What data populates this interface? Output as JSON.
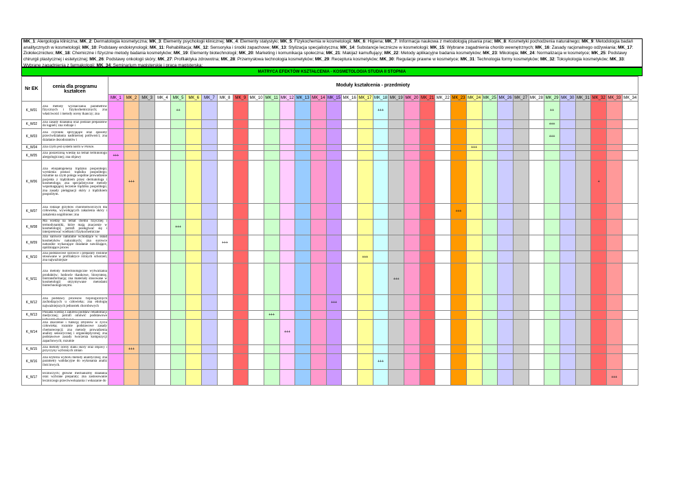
{
  "legend": [
    [
      "MK_1",
      "Alergologia kliniczna"
    ],
    [
      "MK_2",
      "Dermatologia kosmetyczna"
    ],
    [
      "MK_3",
      "Elementy psychologii klinicznej"
    ],
    [
      "MK_4",
      "Elementy statystyki"
    ],
    [
      "MK_5",
      "Fizykochemia w kosmetologii"
    ],
    [
      "MK_6",
      "Higiena"
    ],
    [
      "MK_7",
      "Informacja naukowa z metodologią pisania prac"
    ],
    [
      "MK_8",
      "Kosmetyki pochodzenia naturalnego"
    ],
    [
      "MK_9",
      "Metodologia badań analitycznych w kosmetologii"
    ],
    [
      "MK_10",
      "Podstawy endokrynologii"
    ],
    [
      "MK_11",
      "Rehabilitacja"
    ],
    [
      "MK_12",
      "Sensoryka i środki zapachowe"
    ],
    [
      "MK_13",
      "Stylizacja specjalistyczna"
    ],
    [
      "MK_14",
      "Substancje lecznicze w kosmetologii"
    ],
    [
      "MK_15",
      "Wybrane zagadnienia chorób wewnętrznych"
    ],
    [
      "MK_16",
      "Zasady racjonalnego odżywiania"
    ],
    [
      "MK_17",
      "Ziołolecznictwo"
    ],
    [
      "MK_18",
      "Chemiczne i fizyczne metody badania kosmetyków"
    ],
    [
      "MK_19",
      "Elementy biotechnologii"
    ],
    [
      "MK_20",
      "Marketing i komunikacja społeczna"
    ],
    [
      "MK_21",
      "Makijaż kamuflujący"
    ],
    [
      "MK_22",
      "Metody aplikacyjne badania kosmetyków"
    ],
    [
      "MK_23",
      "Mikologia"
    ],
    [
      "MK_24",
      "Normalizacja w kosmetyce"
    ],
    [
      "MK_25",
      "Podstawy chirurgii plastycznej i estetycznej"
    ],
    [
      "MK_26",
      "Podstawy onkologii skóry"
    ],
    [
      "MK_27",
      "Profilaktyka zdrowotna"
    ],
    [
      "MK_28",
      "Przemysłowa technologia kosmetyków"
    ],
    [
      "MK_29",
      "Receptura kosmetyków"
    ],
    [
      "MK_30",
      "Regulacje prawne w kosmetyce"
    ],
    [
      "MK_31",
      "Technologia formy kosmetyków"
    ],
    [
      "MK_32",
      "Toksykologia kosmetyków"
    ],
    [
      "MK_33",
      "Wybrane zagadnienia z farmakologii"
    ],
    [
      "MK_34",
      "Seminarium magisterskie i praca magisterska"
    ]
  ],
  "title": "MATRYCA EFEKTÓW KSZTAŁCENIA - KOSMETOLOGIA STUDIA II STOPNIA",
  "header": {
    "col_code": "Nr EK",
    "col_desc": "cenia dla programu kształcen",
    "modules_title": "Moduły kształcenia - przedmioty"
  },
  "modules": [
    "MK_1",
    "MK_2",
    "MK_3",
    "MK_4",
    "MK_5",
    "MK_6",
    "MK_7",
    "MK_8",
    "MK_9",
    "MK_10",
    "MK_11",
    "MK_12",
    "MK_13",
    "MK_14",
    "MK_15",
    "MK_16",
    "MK_17",
    "MK_18",
    "MK_19",
    "MK_20",
    "MK_21",
    "MK_22",
    "MK_23",
    "MK_24",
    "MK_25",
    "MK_26",
    "MK_27",
    "MK_28",
    "MK_29",
    "MK_30",
    "MK_31",
    "MK_32",
    "MK_33",
    "MK_34"
  ],
  "column_colors": [
    "#ff99ff",
    "#ffcc99",
    "#cccccc",
    "#ffffff",
    "#ccffcc",
    "#ffff99",
    "#ccccff",
    "#ffffff",
    "#ff6666",
    "#ffffff",
    "#ccffcc",
    "#ffccff",
    "#99ccff",
    "#ff99cc",
    "#cc99ff",
    "#ffffff",
    "#ffff99",
    "#ccffff",
    "#cccccc",
    "#ff99cc",
    "#ff6666",
    "#ffffff",
    "#ff9900",
    "#ffff99",
    "#ccffcc",
    "#ccccff",
    "#cccccc",
    "#ffffff",
    "#ccffcc",
    "#ccccff",
    "#cccccc",
    "#ff6666",
    "#ff9999",
    "#ffffff"
  ],
  "rows": [
    {
      "code": "K_W01",
      "desc": "Zna metody wyznaczania parametrów fizycznych i fizykochemicznych; zna właściwości i metody oceny tkanczy; zna",
      "marks": {
        "4": "++",
        "17": "+++",
        "28": "++"
      }
    },
    {
      "code": "K_W02",
      "desc": "Zna zasady działania oraz podział preparatów do kąpieli; zna rodzaje i",
      "marks": {
        "28": "+++"
      }
    },
    {
      "code": "K_W03",
      "desc": "Zna czynniki sprzyjające oraz sposoby przeciwdziałania nadmiernej potliwości; zna działanie dezodorantów i",
      "marks": {
        "28": "+++"
      }
    },
    {
      "code": "K_W04",
      "desc": "Zna czym jest system norm w Polsce.",
      "marks": {
        "23": "+++"
      }
    },
    {
      "code": "K_W05",
      "desc": "Zna poszerzoną wiedzę na temat terminologii alergologicznej; zna objawy",
      "marks": {
        "0": "+++"
      }
    },
    {
      "code": "K_W06",
      "desc": "Zna etiopatogenezę trądziku pospolitego; wymienia postaci trądziku pospolitego; rozumie na czym polega wspólne prowadzenie pacjenta z trądzikiem przez dermatologa i kosmetologa; zna specjalistyczne metody wspomagającej leczenie trądziku pospolitego; zna zasady pielęgnacji skóry z trądzikiem pospolitym.",
      "marks": {
        "1": "+++",
        "31": "+"
      }
    },
    {
      "code": "K_W07",
      "desc": "Zna rodzaje grzybów chorobotwórczych dla człowieka, wywołujących zakażenia skóry i zakażenia uogólnione; zna",
      "marks": {
        "22": "+++"
      }
    },
    {
      "code": "K_W08",
      "desc": "Ma wiedzę na temat chemii fizycznej i termodynamiki, które mają znaczenie w kosmetologii; potrafi posługiwać się i interpretować wielkości fizykochemiczne",
      "marks": {
        "4": "+++"
      }
    },
    {
      "code": "K_W09",
      "desc": "Zna surowce naturalne wchodzące w skład kosmetyków naturalnych; zna surowce naturalne wykazujące działanie nawilżające, opóźniające proces",
      "marks": {
        "7": "+++"
      }
    },
    {
      "code": "K_W10",
      "desc": "Zna podstawowe surowce i preparaty roślinne stosowane w profilaktyce różnych schorzeń; zna najważniejsze",
      "marks": {
        "16": "+++"
      }
    },
    {
      "code": "K_W11",
      "desc": "Zna metody biotechnologiczne wytwarzania produktów; hodowle tkankowe, biosyntezę, biotransformację; zna materiały stosowane w kosmetologii otrzymywane metodami biotechnologicznymi.",
      "marks": {
        "18": "+++"
      }
    },
    {
      "code": "K_W12",
      "desc": "Zna podstawy procesów fizjologicznych zachodzących u człowieka; zna etiologię najważniejszych jednostek chorobowych",
      "marks": {
        "14": "+++"
      }
    },
    {
      "code": "K_W13",
      "desc": "Posiada wiedzę z zakresu podstaw rehabilitacji medycznej; potrafi omówić podstawowe jednostki chorobowe z",
      "marks": {
        "10": "+++"
      }
    },
    {
      "code": "K_W14",
      "desc": "Zna znaczenie i funkcję zmysłów w życiu człowieka; rozumie podstawowe zasady chemorecepcji; zna metody prowadzenia analizy sensorycznej i organoleptycznej; zna podstawowe zasady tworzenia kompozycji zapachowych; rozumie",
      "marks": {
        "11": "+++"
      }
    },
    {
      "code": "K_W15",
      "desc": "Zna metody oceny stanu skóry oraz objawy i przyczyny wybranych zmian",
      "marks": {
        "1": "+++"
      }
    },
    {
      "code": "K_W16",
      "desc": "Zna kryteria wyboru metody analitycznej; zna parametry walidacyjne do wykonania analiz ilościowych.",
      "marks": {
        "17": "+++"
      }
    },
    {
      "code": "K_W17",
      "desc": "leczniczych; główne mechanizmy działania oraz wybrane preparaty; zna zastosowanie leczniczego przeciwwskazania i wskazanie do",
      "marks": {
        "32": "+++"
      }
    }
  ]
}
